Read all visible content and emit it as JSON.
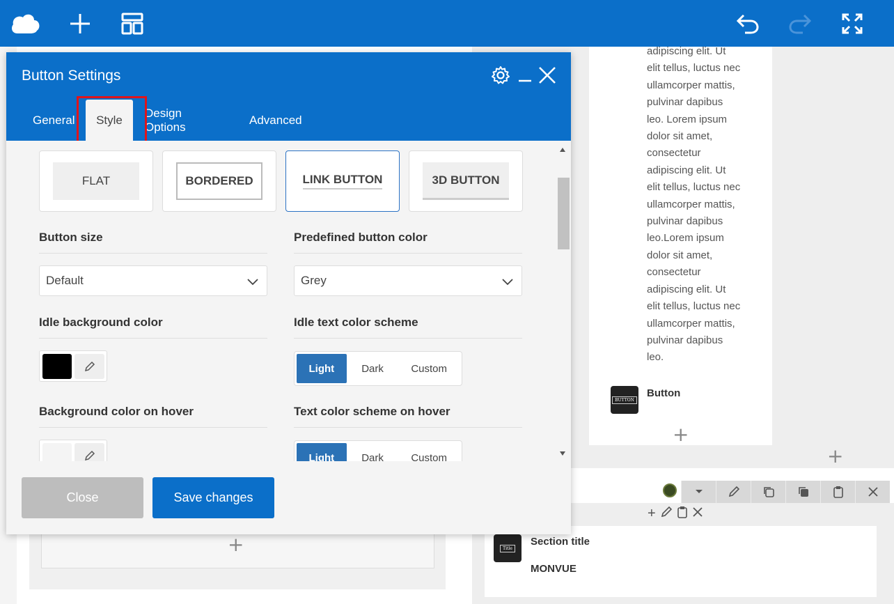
{
  "topbar": {
    "icons": [
      "cloud-logo-icon",
      "plus-icon",
      "layout-icon",
      "undo-icon",
      "redo-icon",
      "fullscreen-icon"
    ]
  },
  "modal": {
    "title": "Button Settings",
    "tabs": [
      {
        "label": "General",
        "active": false
      },
      {
        "label": "Style",
        "active": true
      },
      {
        "label": "Design Options",
        "active": false
      },
      {
        "label": "Advanced",
        "active": false
      }
    ],
    "style_options": [
      {
        "label": "FLAT",
        "selected": false
      },
      {
        "label": "BORDERED",
        "selected": false
      },
      {
        "label": "LINK BUTTON",
        "selected": true
      },
      {
        "label": "3D BUTTON",
        "selected": false
      }
    ],
    "button_size": {
      "label": "Button size",
      "value": "Default"
    },
    "predefined_color": {
      "label": "Predefined button color",
      "value": "Grey"
    },
    "idle_bg": {
      "label": "Idle background color",
      "swatch": "#000000"
    },
    "idle_text_scheme": {
      "label": "Idle text color scheme",
      "options": [
        "Light",
        "Dark",
        "Custom"
      ],
      "selected": "Light"
    },
    "hover_bg": {
      "label": "Background color on hover",
      "swatch": "#f4f4f4"
    },
    "hover_text_scheme": {
      "label": "Text color scheme on hover",
      "options": [
        "Light",
        "Dark",
        "Custom"
      ],
      "selected": "Light"
    },
    "footer": {
      "close_label": "Close",
      "save_label": "Save changes"
    }
  },
  "canvas": {
    "lorem_text": "adipiscing elit. Ut\nelit tellus, luctus nec\nullamcorper mattis,\npulvinar dapibus\nleo. Lorem ipsum\ndolor sit amet,\nconsectetur\nadipiscing elit. Ut\nelit tellus, luctus nec\nullamcorper mattis,\npulvinar dapibus\nleo.Lorem ipsum\ndolor sit amet,\nconsectetur\nadipiscing elit. Ut\nelit tellus, luctus nec\nullamcorper mattis,\npulvinar dapibus\nleo.",
    "button_element": {
      "label": "Button",
      "thumb_text": "BUTTON"
    },
    "section_title_element": {
      "label": "Section title",
      "thumb_text": "Title",
      "value": "MONVUE"
    }
  },
  "colors": {
    "brand_blue": "#0b6fc9",
    "segment_active": "#2b72b6",
    "highlight_red": "#e0141b"
  }
}
